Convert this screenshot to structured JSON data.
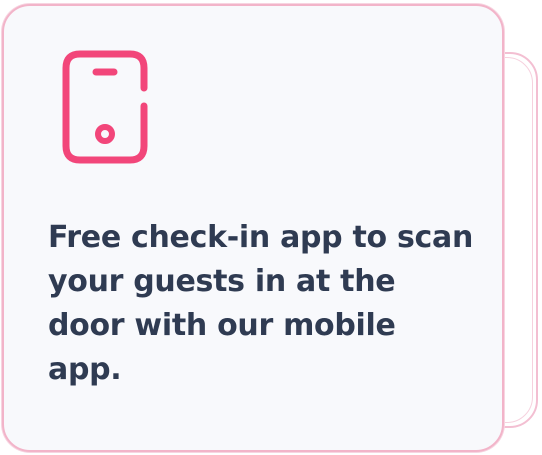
{
  "card": {
    "description": "Free check-in app to scan your guests in at the door with our mobile app.",
    "icon": "mobile-phone-icon"
  },
  "colors": {
    "accent": "#f2467a",
    "text": "#2f3b52",
    "card_background": "#f8f9fc",
    "card_border": "#f2b4c9"
  }
}
